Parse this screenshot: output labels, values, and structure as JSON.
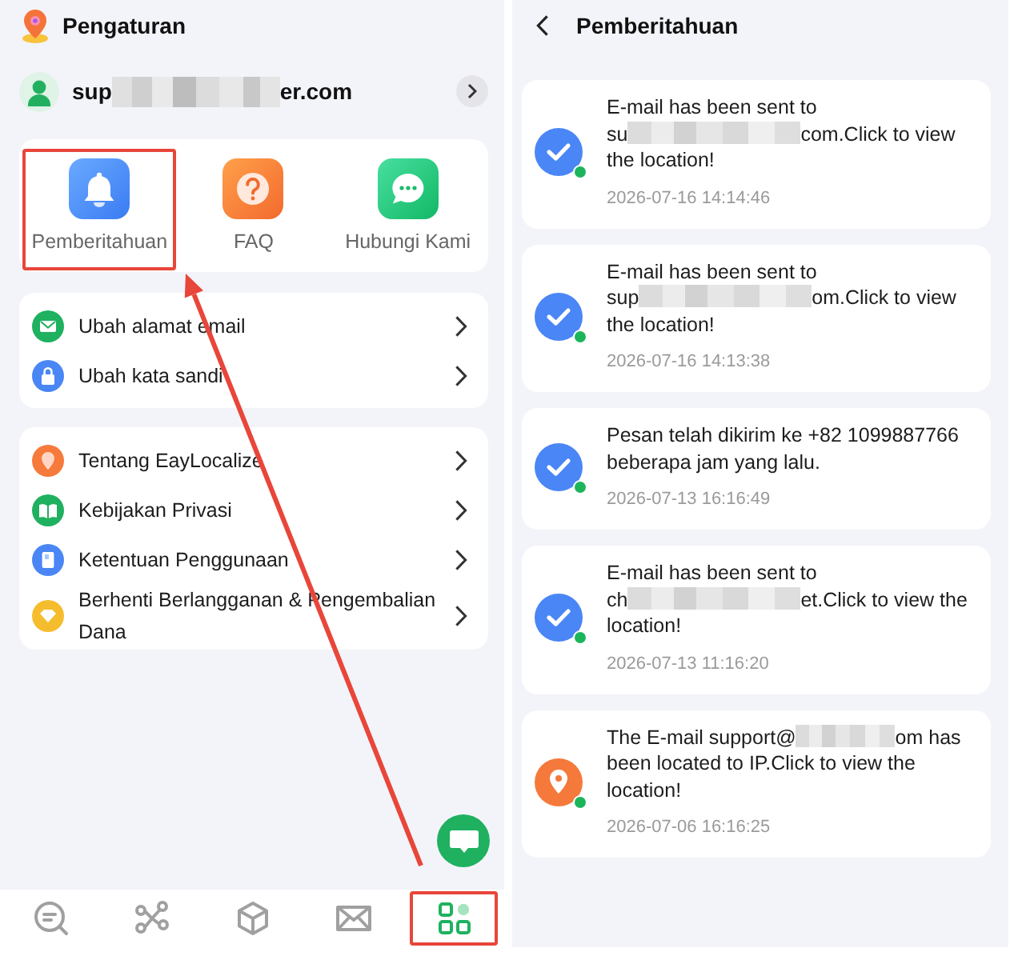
{
  "settings": {
    "title": "Pengaturan",
    "account": {
      "email_parts": [
        "sup",
        "er.com"
      ]
    },
    "quick_actions": [
      {
        "kind": "bell",
        "label": "Pemberitahuan",
        "highlighted": true
      },
      {
        "kind": "question",
        "label": "FAQ",
        "highlighted": false
      },
      {
        "kind": "chat",
        "label": "Hubungi Kami",
        "highlighted": false
      }
    ],
    "menu_groups": [
      {
        "items": [
          {
            "kind": "email",
            "label": "Ubah alamat email"
          },
          {
            "kind": "lock",
            "label": "Ubah kata sandi"
          }
        ]
      },
      {
        "items": [
          {
            "kind": "pin",
            "label": "Tentang EayLocalize"
          },
          {
            "kind": "book",
            "label": "Kebijakan Privasi"
          },
          {
            "kind": "document",
            "label": "Ketentuan Penggunaan"
          },
          {
            "kind": "diamond",
            "label": "Berhenti Berlangganan & Pengembalian Dana"
          }
        ]
      }
    ],
    "bottom_nav": [
      {
        "kind": "search",
        "selected": false,
        "highlighted": false
      },
      {
        "kind": "share",
        "selected": false,
        "highlighted": false
      },
      {
        "kind": "cube",
        "selected": false,
        "highlighted": false
      },
      {
        "kind": "mail",
        "selected": false,
        "highlighted": false
      },
      {
        "kind": "apps",
        "selected": true,
        "highlighted": true
      }
    ],
    "annotation_arrow": true
  },
  "notifications": {
    "title": "Pemberitahuan",
    "items": [
      {
        "kind": "check",
        "text_parts": [
          "E-mail has been sent to su",
          "com.Click to view the location!"
        ],
        "time": "2026-07-16 14:14:46",
        "unread": true
      },
      {
        "kind": "check",
        "text_parts": [
          "E-mail has been sent to sup",
          "om.Click to view the location!"
        ],
        "time": "2026-07-16 14:13:38",
        "unread": true
      },
      {
        "kind": "check",
        "text_parts": [
          "Pesan telah dikirim ke +82 1099887766 beberapa jam yang lalu."
        ],
        "time": "2026-07-13 16:16:49",
        "unread": true
      },
      {
        "kind": "check",
        "text_parts": [
          "E-mail has been sent to ch",
          "et.Click to view the location!"
        ],
        "time": "2026-07-13 11:16:20",
        "unread": true
      },
      {
        "kind": "pin",
        "text_parts": [
          "The E-mail support@",
          "om has been located to IP.Click to view the location!"
        ],
        "time": "2026-07-06 16:16:25",
        "unread": true
      }
    ]
  }
}
